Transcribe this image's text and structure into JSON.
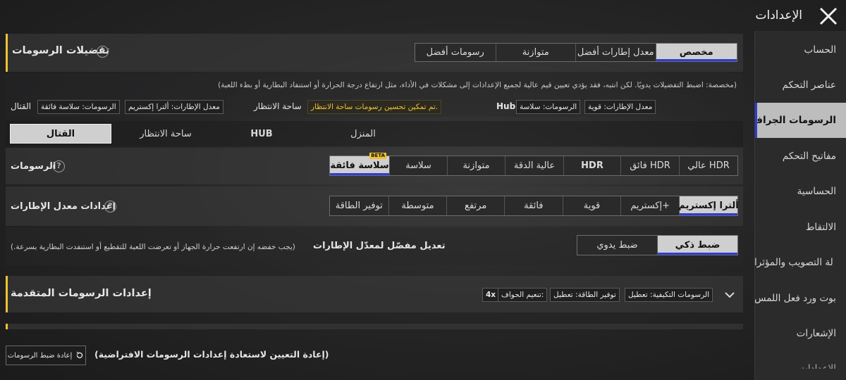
{
  "header": {
    "title": "الإعدادات"
  },
  "sidebar": {
    "items": [
      {
        "label": "الحساب"
      },
      {
        "label": "عناصر التحكم"
      },
      {
        "label": "الرسومات الجرافيكية"
      },
      {
        "label": "مفاتيح التحكم"
      },
      {
        "label": "الحساسية"
      },
      {
        "label": "الالتقاط"
      },
      {
        "label": "لة التصويب والمؤثرا"
      },
      {
        "label": "بوت ورد فعل اللمس"
      },
      {
        "label": "الإشعارات"
      },
      {
        "label": "الإعدادات"
      }
    ],
    "active_index": 2
  },
  "graphics_prefs": {
    "title": "تفضيلات الرسومات",
    "options": [
      "رسومات أفضل",
      "متوازنة",
      "معدل إطارات أفضل",
      "مخصص"
    ],
    "selected": "مخصص",
    "description": "(مخصصة: اضبط التفضيلات يدويًا. لكن انتبه، فقد يؤدي تعيين قيم عالية لجميع الإعدادات إلى مشكلات في الأداء، مثل ارتفاع درجة الحرارة أو استنفاد البطارية أو بطء اللعبة)",
    "summary": {
      "combat_label": "القتال",
      "combat_graphics": "الرسومات: سلاسة فائقة",
      "combat_fps": "معدل الإطارات: ألترا إكستريم",
      "lobby_label": "ساحة الانتظار",
      "lobby_notice": "تم تمكين تحسين رسومات ساحة الانتظار.",
      "hub_label": "Hub",
      "hub_graphics": "الرسومات: سلاسة",
      "hub_fps": "معدل الإطارات: قوية"
    }
  },
  "mode_tabs": {
    "items": [
      "القتال",
      "ساحة الانتظار",
      "HUB",
      "المنزل"
    ],
    "selected": "القتال"
  },
  "graphics": {
    "label": "الرسومات",
    "options": [
      "سلاسة فائقة",
      "سلاسة",
      "متوازنة",
      "عالية الدقة",
      "HDR",
      "فائق HDR",
      "عالي HDR"
    ],
    "selected": "سلاسة فائقة",
    "beta_badge": "BETA"
  },
  "fps": {
    "label": "إعدادات معدل الإطارات",
    "options": [
      "توفير الطاقة",
      "متوسطة",
      "مرتفع",
      "فائقة",
      "قوية",
      "إكستريم+",
      "ألترا إكستريم"
    ],
    "selected": "ألترا إكستريم"
  },
  "adaptive": {
    "label": "تعديل مفصّل لمعدّل الإطارات",
    "note": "(يجب خفضه إن ارتفعت حرارة الجهاز أو تعرضت اللعبة للتقطيع أو استنفدت البطارية بسرعة.)",
    "options": [
      "ضبط يدوي",
      "ضبط ذكي"
    ],
    "selected": "ضبط ذكي"
  },
  "advanced": {
    "title": "إعدادات الرسومات المتقدمة",
    "chips": [
      "الرسومات التكيفية: تعطيل",
      "توفير الطاقة: تعطيل",
      "تنعيم الحواف:",
      "4x"
    ]
  },
  "reset": {
    "button_label": "إعادة ضبط الرسومات",
    "note": "(إعادة التعيين لاستعادة إعدادات الرسومات الافتراضية)"
  },
  "colors": {
    "accent_yellow": "#f0c232",
    "selected_underline": "#2f3bd6",
    "selected_bg": "#cfcfcf"
  }
}
